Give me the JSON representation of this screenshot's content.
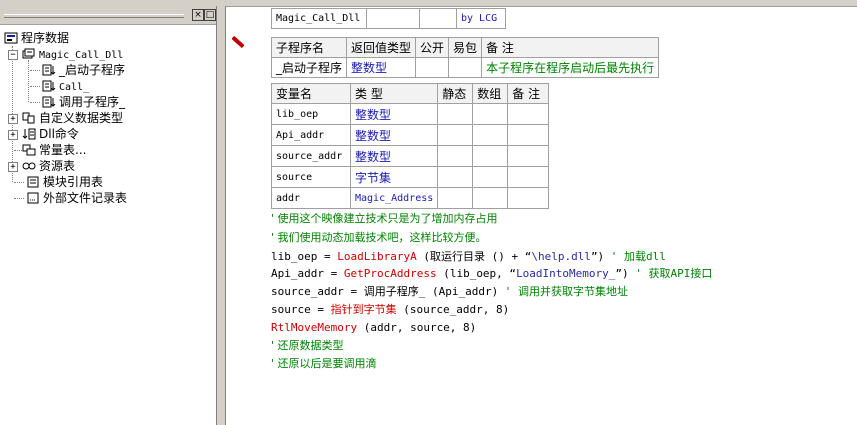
{
  "sidebar": {
    "items": [
      {
        "label": "程序数据"
      },
      {
        "label": "Magic_Call_Dll"
      },
      {
        "label": "_启动子程序"
      },
      {
        "label": "Call_"
      },
      {
        "label": "调用子程序_"
      },
      {
        "label": "自定义数据类型"
      },
      {
        "label": "Dll命令"
      },
      {
        "label": "常量表..."
      },
      {
        "label": "资源表"
      },
      {
        "label": "模块引用表"
      },
      {
        "label": "外部文件记录表"
      }
    ]
  },
  "assembly_table": {
    "name": "Magic_Call_Dll",
    "author": "by LCG"
  },
  "sub_table": {
    "headers": [
      "子程序名",
      "返回值类型",
      "公开",
      "易包",
      "备 注"
    ],
    "row": [
      "_启动子程序",
      "整数型",
      "",
      "",
      "本子程序在程序启动后最先执行"
    ]
  },
  "var_table": {
    "headers": [
      "变量名",
      "类 型",
      "静态",
      "数组",
      "备 注"
    ],
    "rows": [
      [
        "lib_oep",
        "整数型",
        "",
        "",
        ""
      ],
      [
        "Api_addr",
        "整数型",
        "",
        "",
        ""
      ],
      [
        "source_addr",
        "整数型",
        "",
        "",
        ""
      ],
      [
        "source",
        "字节集",
        "",
        "",
        ""
      ],
      [
        "addr",
        "Magic_Address",
        "",
        "",
        ""
      ]
    ]
  },
  "code": {
    "c1": "' 使用这个映像建立技术只是为了增加内存占用",
    "c2": "' 我们使用动态加载技术吧，这样比较方便。",
    "l3a": "lib_oep = ",
    "l3fn": "LoadLibraryA",
    "l3b": " (取运行目录 () + “",
    "l3s": "\\help.dll",
    "l3c": "”)",
    "l3cm": "  ' 加载dll",
    "l4a": "Api_addr = ",
    "l4fn": "GetProcAddress",
    "l4b": " (lib_oep, “",
    "l4s": "LoadIntoMemory_",
    "l4c": "”)",
    "l4cm": "  ' 获取API接口",
    "l5a": "source_addr = 调用子程序_ (Api_addr)",
    "l5cm": "  ' 调用并获取字节集地址",
    "l6a": "source = ",
    "l6fn": "指针到字节集",
    "l6b": " (source_addr, 8)",
    "l7fn": "RtlMoveMemory",
    "l7b": " (addr, source, 8)",
    "c8": "' 还原数据类型",
    "c9": "' 还原以后是要调用滴"
  },
  "colors": {
    "comment": "#008000",
    "function": "#cc0000",
    "type": "#1a1ab0",
    "string": "#2a2aa0"
  }
}
